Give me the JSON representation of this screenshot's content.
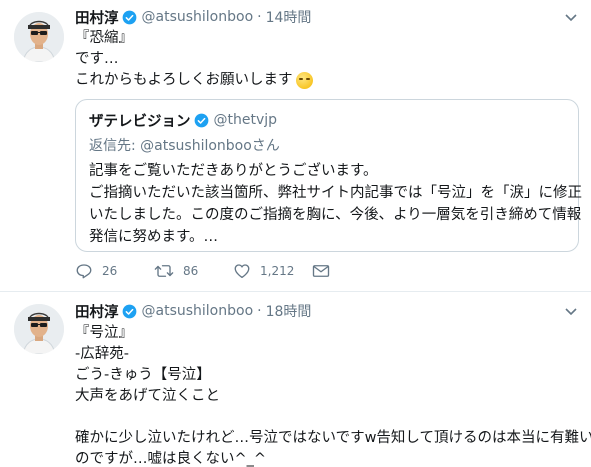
{
  "tweets": [
    {
      "display_name": "田村淳",
      "handle": "@atsushilonboo",
      "separator": "·",
      "time": "14時間",
      "lines": [
        "『恐縮』",
        "です…",
        "これからもよろしくお願いします"
      ],
      "emoji": "smiling-face-emoji",
      "quoted": {
        "display_name": "ザテレビジョン",
        "handle": "@thetvjp",
        "reply_to": "返信先: @atsushilonbooさん",
        "lines": [
          "記事をご覧いただきありがとうございます。",
          "ご指摘いただいた該当箇所、弊社サイト内記事では「号泣」を「涙」に修正",
          "いたしました。この度のご指摘を胸に、今後、より一層気を引き締めて情報",
          "発信に努めます。…"
        ]
      },
      "actions": {
        "replies": "26",
        "retweets": "86",
        "likes": "1,212"
      }
    },
    {
      "display_name": "田村淳",
      "handle": "@atsushilonboo",
      "separator": "·",
      "time": "18時間",
      "lines": [
        "『号泣』",
        "-広辞苑-",
        "ごう‐きゅう【号泣】",
        "大声をあげて泣くこと",
        "",
        "確かに少し泣いたけれど…号泣ではないですw告知して頂けるのは本当に有難い",
        "のですが…嘘は良くない^_^"
      ]
    }
  ],
  "colors": {
    "text": "#14171a",
    "muted": "#657786",
    "verified": "#1da1f2",
    "border": "#e6ecf0",
    "quote_border": "#ccd6dd"
  },
  "icons": [
    "avatar",
    "verified-badge-icon",
    "caret-down-icon",
    "reply-icon",
    "retweet-icon",
    "like-icon",
    "direct-message-icon"
  ]
}
